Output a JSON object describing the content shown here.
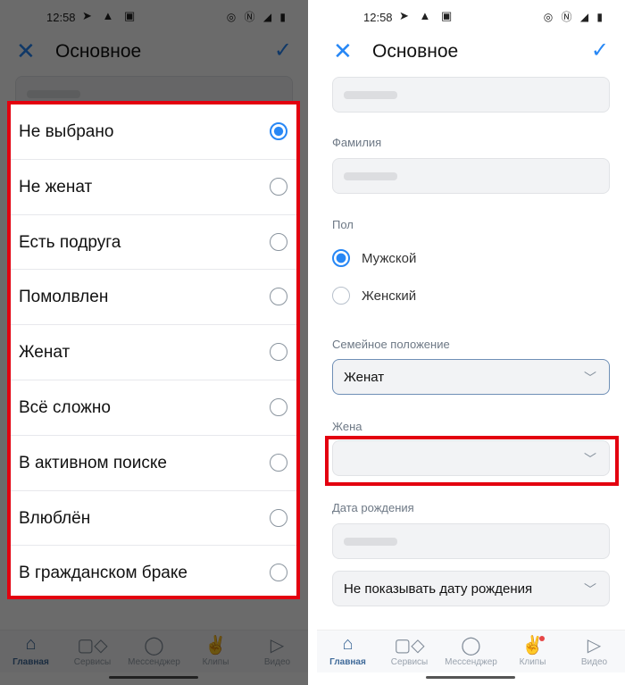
{
  "status": {
    "time": "12:58",
    "left_icons": [
      "telegram-icon",
      "android-icon",
      "screenshot-icon"
    ],
    "right_icons": [
      "nfc-icon",
      "signal-4g-icon",
      "battery-icon"
    ]
  },
  "header": {
    "title": "Основное",
    "close_icon": "close-icon",
    "confirm_icon": "check-icon"
  },
  "dialog": {
    "options": [
      {
        "label": "Не выбрано",
        "selected": true
      },
      {
        "label": "Не женат",
        "selected": false
      },
      {
        "label": "Есть подруга",
        "selected": false
      },
      {
        "label": "Помолвлен",
        "selected": false
      },
      {
        "label": "Женат",
        "selected": false
      },
      {
        "label": "Всё сложно",
        "selected": false
      },
      {
        "label": "В активном поиске",
        "selected": false
      },
      {
        "label": "Влюблён",
        "selected": false
      },
      {
        "label": "В гражданском браке",
        "selected": false
      }
    ]
  },
  "form": {
    "surname_label": "Фамилия",
    "gender_label": "Пол",
    "gender_options": [
      {
        "label": "Мужской",
        "selected": true
      },
      {
        "label": "Женский",
        "selected": false
      }
    ],
    "marital_label": "Семейное положение",
    "marital_value": "Женат",
    "spouse_label": "Жена",
    "spouse_value": "",
    "birthdate_label": "Дата рождения",
    "birthdate_visibility": "Не показывать дату рождения"
  },
  "nav": {
    "items": [
      {
        "label": "Главная",
        "icon": "home-icon",
        "active": true
      },
      {
        "label": "Сервисы",
        "icon": "services-icon"
      },
      {
        "label": "Мессенджер",
        "icon": "messenger-icon"
      },
      {
        "label": "Клипы",
        "icon": "clips-icon",
        "badge": true
      },
      {
        "label": "Видео",
        "icon": "video-icon"
      }
    ]
  },
  "colors": {
    "accent": "#2787f5",
    "highlight": "#e3000f"
  }
}
